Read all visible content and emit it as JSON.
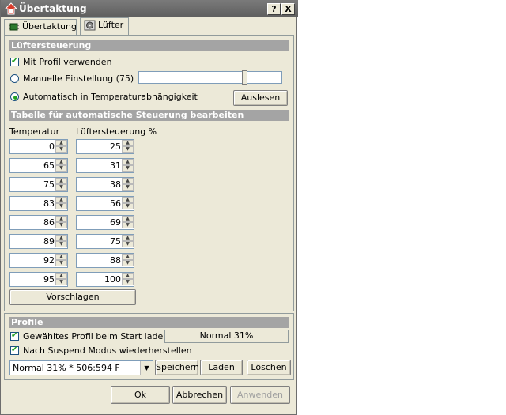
{
  "window": {
    "title": "Übertaktung",
    "help_label": "?",
    "close_label": "X"
  },
  "tabs": [
    {
      "label": "Übertaktung"
    },
    {
      "label": "Lüfter"
    }
  ],
  "fan": {
    "section_title": "Lüftersteuerung",
    "use_profile_label": "Mit Profil verwenden",
    "use_profile_checked": true,
    "manual_label": "Manuelle Einstellung (75)",
    "manual_value": 75,
    "auto_label": "Automatisch in Temperaturabhängigkeit",
    "read_button": "Auslesen"
  },
  "table": {
    "section_title": "Tabelle für automatische Steuerung bearbeiten",
    "col_temp": "Temperatur",
    "col_fan": "Lüftersteuerung %",
    "rows": [
      {
        "temp": "0",
        "fan": "25"
      },
      {
        "temp": "65",
        "fan": "31"
      },
      {
        "temp": "75",
        "fan": "38"
      },
      {
        "temp": "83",
        "fan": "56"
      },
      {
        "temp": "86",
        "fan": "69"
      },
      {
        "temp": "89",
        "fan": "75"
      },
      {
        "temp": "92",
        "fan": "88"
      },
      {
        "temp": "95",
        "fan": "100"
      }
    ],
    "suggest_button": "Vorschlagen"
  },
  "profile": {
    "section_title": "Profile",
    "load_on_start_label": "Gewähltes Profil beim Start laden",
    "load_on_start_checked": true,
    "current_profile": "Normal 31%",
    "restore_after_suspend_label": "Nach Suspend Modus wiederherstellen",
    "restore_after_suspend_checked": true,
    "combo_value": "Normal 31% * 506:594   F",
    "save_button": "Speichern",
    "load_button": "Laden",
    "delete_button": "Löschen"
  },
  "dialog": {
    "ok_button": "Ok",
    "cancel_button": "Abbrechen",
    "apply_button": "Anwenden"
  }
}
